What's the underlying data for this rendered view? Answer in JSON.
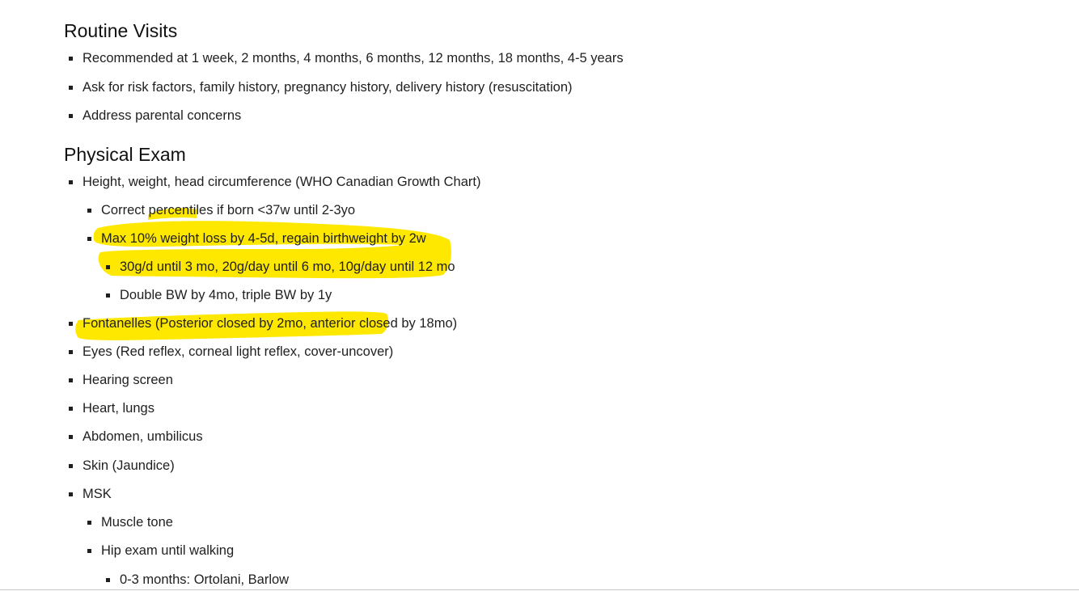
{
  "sections": [
    {
      "heading": "Routine Visits",
      "items": [
        "Recommended at 1 week, 2 months, 4 months, 6 months, 12 months, 18 months, 4-5 years",
        "Ask for risk factors, family history, pregnancy history, delivery history (resuscitation)",
        "Address parental concerns"
      ]
    },
    {
      "heading": "Physical Exam",
      "items": {
        "growth": "Height, weight, head circumference (WHO Canadian Growth Chart)",
        "growth_sub": [
          "Correct percentiles if born <37w until 2-3yo",
          "Max 10% weight loss by 4-5d, regain birthweight by 2w"
        ],
        "growth_sub_sub": [
          "30g/d until 3 mo, 20g/day until 6 mo, 10g/day until 12 mo",
          "Double BW by 4mo, triple BW by 1y"
        ],
        "fontanelles": "Fontanelles (Posterior closed by 2mo, anterior closed by 18mo)",
        "eyes": "Eyes (Red reflex, corneal light reflex, cover-uncover)",
        "hearing": "Hearing screen",
        "heart": "Heart, lungs",
        "abdomen": "Abdomen, umbilicus",
        "skin": "Skin (Jaundice)",
        "msk": "MSK",
        "msk_sub": [
          "Muscle tone",
          "Hip exam until walking"
        ],
        "msk_sub_sub": [
          "0-3 months: Ortolani, Barlow"
        ]
      }
    }
  ],
  "colors": {
    "highlight": "#ffe800",
    "text": "#1f1f1f",
    "background": "#ffffff"
  }
}
